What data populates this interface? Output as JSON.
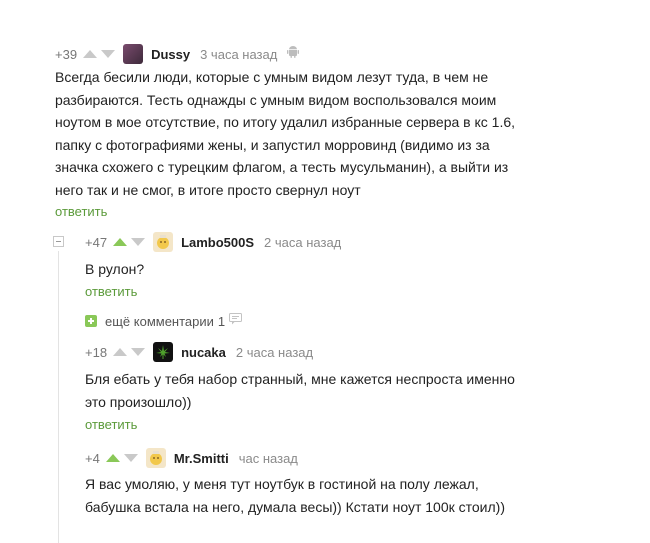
{
  "comments": [
    {
      "rating": "+39",
      "username": "Dussy",
      "time": "3 часа назад",
      "platform_icon": "android-icon",
      "text_lines": [
        "Всегда бесили люди, которые с умным видом лезут туда, в чем не",
        "разбираются. Тесть однажды с умным видом воспользовался моим",
        "ноутом в мое отсутствие, по итогу удалил избранные сервера в кс 1.6,",
        "папку с фотографиями жены, и запустил морровинд (видимо из за",
        "значка схожего с турецким флагом, а тесть мусульманин), а выйти из",
        "него так и не смог, в итоге просто свернул ноут"
      ],
      "reply_label": "ответить"
    },
    {
      "rating": "+47",
      "username": "Lambo500S",
      "time": "2 часа назад",
      "text_lines": [
        "В рулон?"
      ],
      "reply_label": "ответить"
    },
    {
      "rating": "+18",
      "username": "nucaka",
      "time": "2 часа назад",
      "text_lines": [
        "Бля ебать у тебя набор странный, мне кажется неспроста именно",
        "это произошло))"
      ],
      "reply_label": "ответить"
    },
    {
      "rating": "+4",
      "username": "Mr.Smitti",
      "time": "час назад",
      "text_lines": [
        "Я вас умоляю, у меня тут ноутбук в гостиной на полу лежал,",
        "бабушка встала на него, думала весы)) Кстати ноут 100к стоил))"
      ]
    }
  ],
  "more_comments": {
    "label": "ещё комментарии",
    "count": "1"
  },
  "colors": {
    "upvote_active": "#8ac858",
    "vote_inactive": "#c9c9c9",
    "reply_link": "#5b9a3a",
    "more_plus": "#8ac858"
  }
}
